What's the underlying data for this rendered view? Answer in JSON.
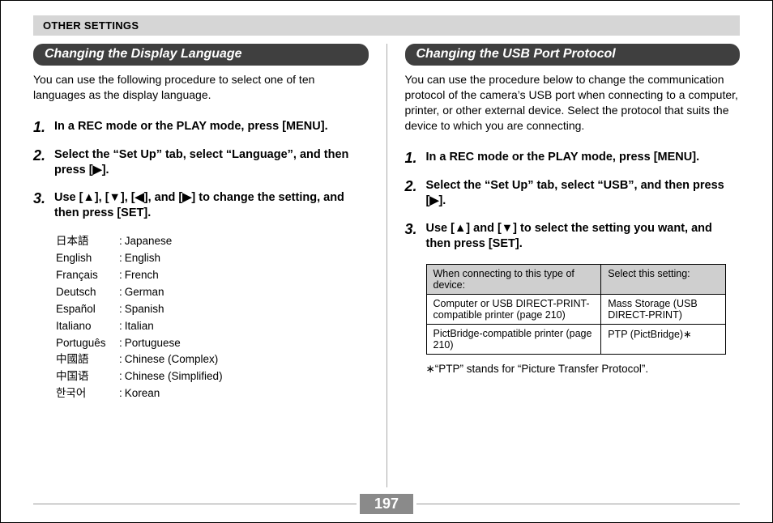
{
  "header": "OTHER SETTINGS",
  "page_number": "197",
  "left": {
    "title": "Changing the Display Language",
    "intro": "You can use the following procedure to select one of ten languages as the display language.",
    "steps": [
      {
        "n": "1.",
        "t": "In a REC mode or the PLAY mode, press [MENU]."
      },
      {
        "n": "2.",
        "t": "Select the “Set Up” tab, select “Language”, and then press [▶]."
      },
      {
        "n": "3.",
        "t": "Use [▲], [▼], [◀], and [▶] to change the setting, and then press [SET]."
      }
    ],
    "languages": [
      {
        "native": "日本語",
        "name": "Japanese"
      },
      {
        "native": "English",
        "name": "English"
      },
      {
        "native": "Français",
        "name": "French"
      },
      {
        "native": "Deutsch",
        "name": "German"
      },
      {
        "native": "Español",
        "name": "Spanish"
      },
      {
        "native": "Italiano",
        "name": "Italian"
      },
      {
        "native": "Português",
        "name": "Portuguese"
      },
      {
        "native": "中國語",
        "name": "Chinese (Complex)"
      },
      {
        "native": "中国语",
        "name": "Chinese (Simplified)"
      },
      {
        "native": "한국어",
        "name": "Korean"
      }
    ]
  },
  "right": {
    "title": "Changing the USB Port Protocol",
    "intro": "You can use the procedure below to change the communication protocol of the camera’s USB port when connecting to a computer, printer, or other external device. Select the protocol that suits the device to which you are connecting.",
    "steps": [
      {
        "n": "1.",
        "t": "In a REC mode or the PLAY mode, press [MENU]."
      },
      {
        "n": "2.",
        "t": "Select the “Set Up” tab, select “USB”, and then press [▶]."
      },
      {
        "n": "3.",
        "t": "Use [▲] and [▼] to select the setting you want, and then press [SET]."
      }
    ],
    "table": {
      "header": [
        "When connecting to this type of device:",
        "Select this setting:"
      ],
      "rows": [
        [
          "Computer or USB DIRECT-PRINT-compatible printer (page 210)",
          "Mass Storage (USB DIRECT-PRINT)"
        ],
        [
          "PictBridge-compatible printer (page 210)",
          "PTP (PictBridge)∗"
        ]
      ]
    },
    "footnote": "∗“PTP” stands for “Picture Transfer Protocol”."
  }
}
